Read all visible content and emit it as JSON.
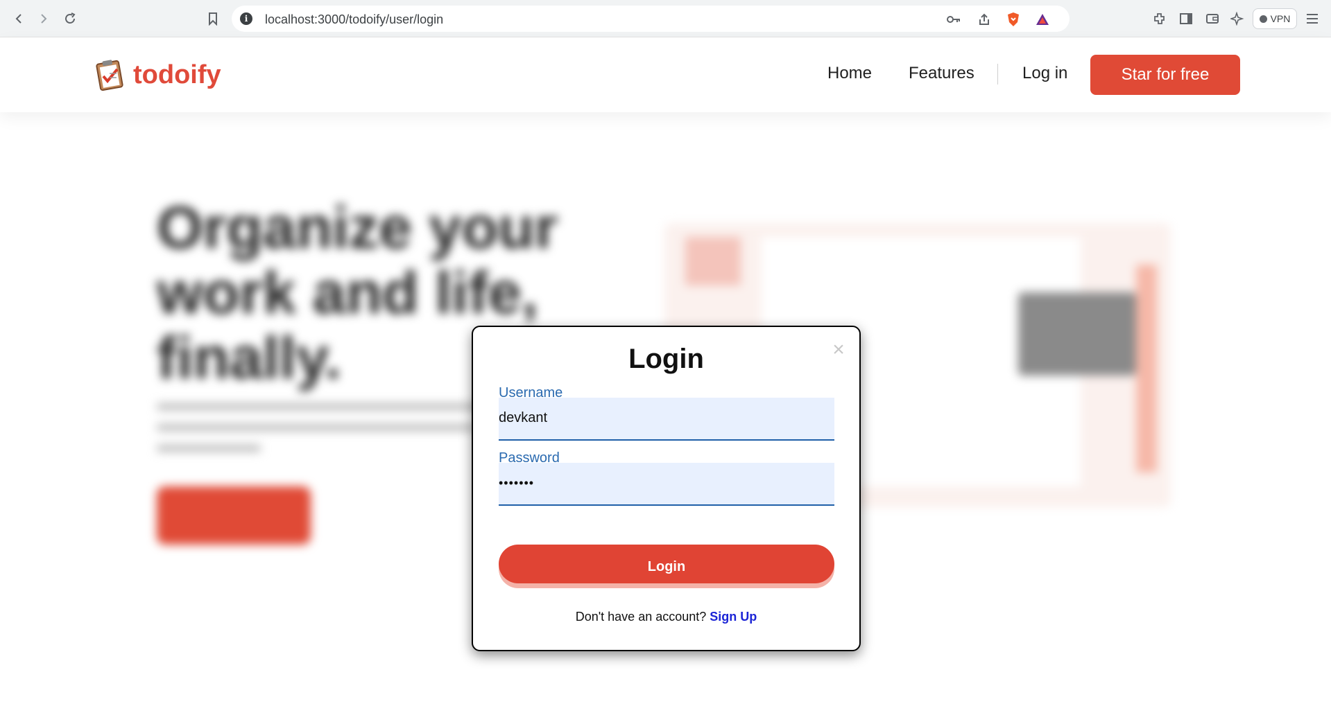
{
  "browser": {
    "url": "localhost:3000/todoify/user/login",
    "vpn_label": "VPN"
  },
  "header": {
    "brand": "todoify",
    "nav": [
      "Home",
      "Features",
      "Log in"
    ],
    "cta_label": "Star for free"
  },
  "hero": {
    "headline": "Organize your work and life, finally."
  },
  "login_modal": {
    "title": "Login",
    "close_glyph": "×",
    "username_label": "Username",
    "username_value": "devkant",
    "password_label": "Password",
    "password_value": "•••••••",
    "submit_label": "Login",
    "signup_prompt": "Don't have an account?",
    "signup_link": "Sign Up"
  },
  "colors": {
    "brand": "#e04a3a",
    "cta": "#e04a36",
    "label": "#2a6ab0",
    "link": "#1b24d6"
  }
}
